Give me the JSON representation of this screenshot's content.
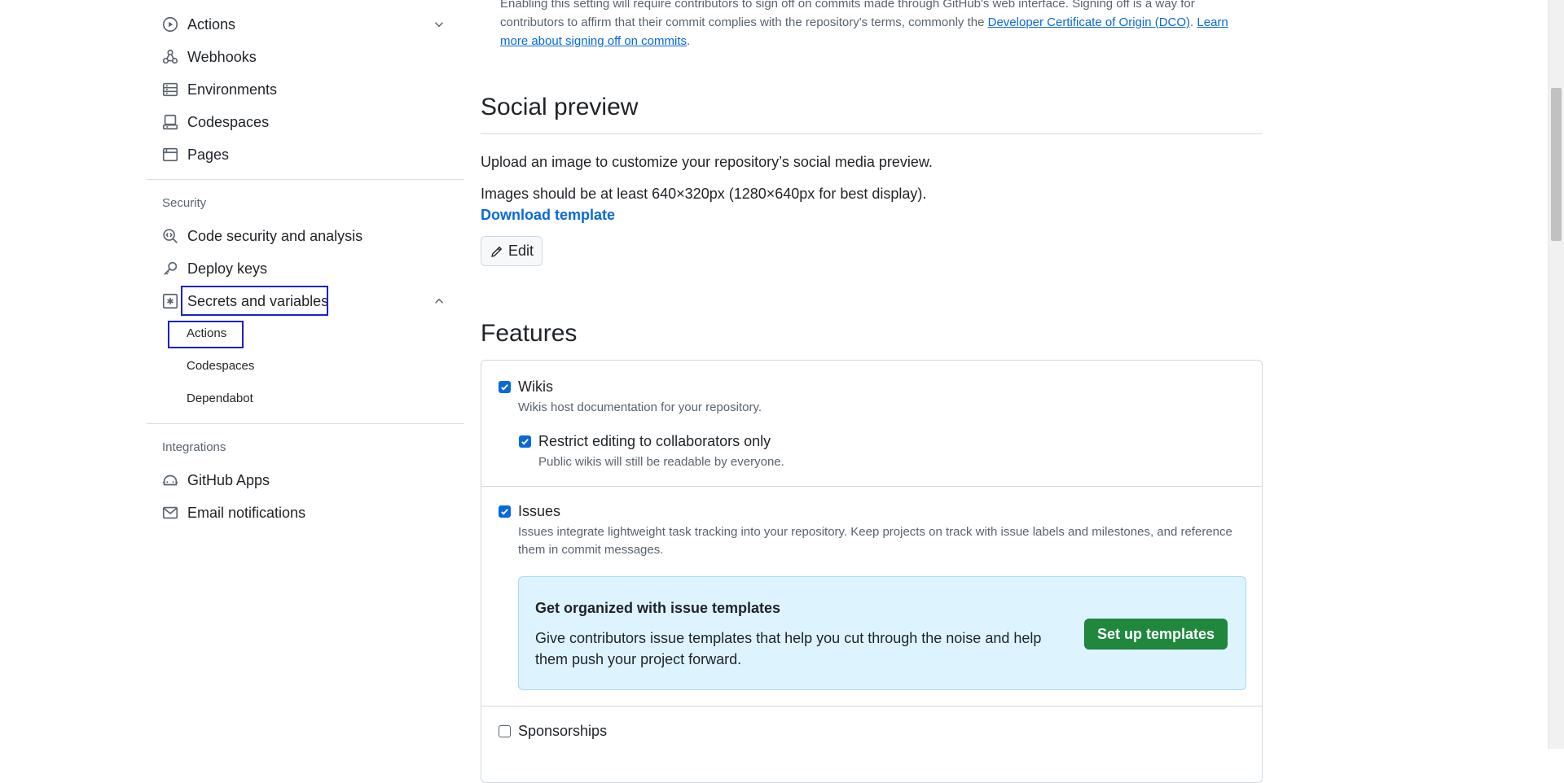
{
  "sidebar": {
    "top_items": [
      {
        "label": "Actions",
        "icon": "play-icon"
      },
      {
        "label": "Webhooks",
        "icon": "webhook-icon"
      },
      {
        "label": "Environments",
        "icon": "server-icon"
      },
      {
        "label": "Codespaces",
        "icon": "codespaces-icon"
      },
      {
        "label": "Pages",
        "icon": "browser-icon"
      }
    ],
    "security": {
      "heading": "Security",
      "items": [
        {
          "label": "Code security and analysis",
          "icon": "codescan-icon"
        },
        {
          "label": "Deploy keys",
          "icon": "key-icon"
        },
        {
          "label": "Secrets and variables",
          "icon": "asterisk-icon"
        }
      ],
      "sub_items": [
        "Actions",
        "Codespaces",
        "Dependabot"
      ]
    },
    "integrations": {
      "heading": "Integrations",
      "items": [
        {
          "label": "GitHub Apps",
          "icon": "robot-icon"
        },
        {
          "label": "Email notifications",
          "icon": "mail-icon"
        }
      ]
    }
  },
  "main": {
    "dco": {
      "text": "Enabling this setting will require contributors to sign off on commits made through GitHub's web interface. Signing off is a way for contributors to affirm that their commit complies with the repository's terms, commonly the ",
      "link1": "Developer Certificate of Origin (DCO)",
      "between": ". ",
      "link2": "Learn more about signing off on commits",
      "end": "."
    },
    "social": {
      "title": "Social preview",
      "desc": "Upload an image to customize your repository’s social media preview.",
      "size_note": "Images should be at least 640×320px (1280×640px for best display).",
      "download": "Download template",
      "edit": "Edit"
    },
    "features": {
      "title": "Features",
      "wikis": {
        "label": "Wikis",
        "desc": "Wikis host documentation for your repository.",
        "checked": true
      },
      "restrict": {
        "label": "Restrict editing to collaborators only",
        "desc": "Public wikis will still be readable by everyone.",
        "checked": true
      },
      "issues": {
        "label": "Issues",
        "desc": "Issues integrate lightweight task tracking into your repository. Keep projects on track with issue labels and milestones, and reference them in commit messages.",
        "checked": true
      },
      "templates": {
        "title": "Get organized with issue templates",
        "desc": "Give contributors issue templates that help you cut through the noise and help them push your project forward.",
        "button": "Set up templates"
      },
      "sponsorships": {
        "label": "Sponsorships",
        "checked": false
      }
    }
  },
  "colors": {
    "accent": "#0969da",
    "primary_button": "#1f883d",
    "highlight": "#1a1fd1",
    "banner_bg": "#ddf4ff"
  }
}
